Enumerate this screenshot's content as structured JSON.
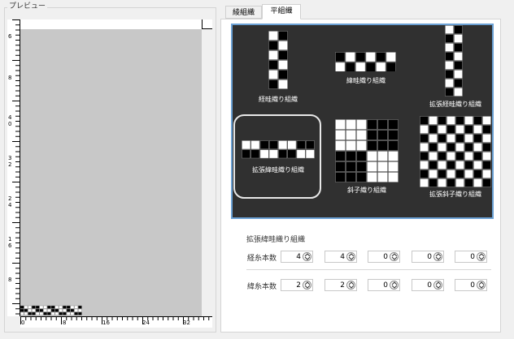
{
  "preview": {
    "legend": "プレビュー"
  },
  "ruler": {
    "v_labels": [
      "6",
      "8",
      "4",
      "0",
      "3",
      "2",
      "2",
      "4",
      "1",
      "6",
      "8"
    ],
    "h_labels": [
      "0",
      "8",
      "16",
      "24",
      "32"
    ]
  },
  "tabs": [
    {
      "label": "綾組織"
    },
    {
      "label": "平組織",
      "active": true
    }
  ],
  "weaves": [
    {
      "label": "経畦織り組織"
    },
    {
      "label": "緯畦織り組織"
    },
    {
      "label": "拡張経畦織り組織"
    },
    {
      "label": "拡張緯畦織り組織",
      "selected": true
    },
    {
      "label": "斜子織り組織"
    },
    {
      "label": "拡張斜子織り組織"
    }
  ],
  "settings": {
    "title": "拡張緯畦織り組織",
    "rows": [
      {
        "label": "経糸本数",
        "values": [
          "4",
          "4",
          "0",
          "0",
          "0"
        ]
      },
      {
        "label": "緯糸本数",
        "values": [
          "2",
          "2",
          "0",
          "0",
          "0"
        ]
      }
    ]
  },
  "colors": {
    "palette_bg": "#303030",
    "selection_border": "#6aa0d4",
    "canvas": "#c8c8c8"
  }
}
